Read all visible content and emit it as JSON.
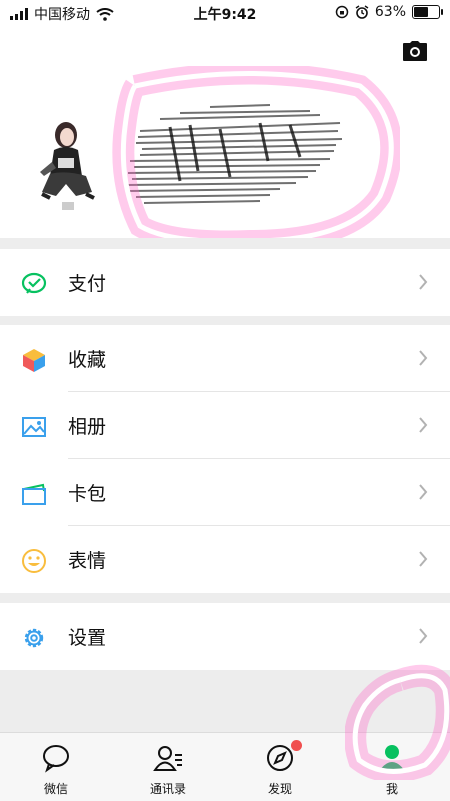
{
  "status_bar": {
    "carrier": "中国移动",
    "time": "上午9:42",
    "battery": "63%",
    "battery_level": 0.63
  },
  "menu": [
    {
      "label": "支付",
      "icon": "wechat-pay-icon"
    },
    {
      "label": "收藏",
      "icon": "cube-icon"
    },
    {
      "label": "相册",
      "icon": "photo-album-icon"
    },
    {
      "label": "卡包",
      "icon": "card-wallet-icon"
    },
    {
      "label": "表情",
      "icon": "smiley-icon"
    },
    {
      "label": "设置",
      "icon": "gear-icon"
    }
  ],
  "tabs": [
    {
      "label": "微信",
      "icon": "chat-bubble-icon"
    },
    {
      "label": "通讯录",
      "icon": "contacts-icon"
    },
    {
      "label": "发现",
      "icon": "compass-icon",
      "badge": true
    },
    {
      "label": "我",
      "icon": "person-icon",
      "active": true
    }
  ],
  "colors": {
    "accent": "#07c160",
    "highlight": "#ff69c8",
    "badge": "#f04f4f"
  }
}
